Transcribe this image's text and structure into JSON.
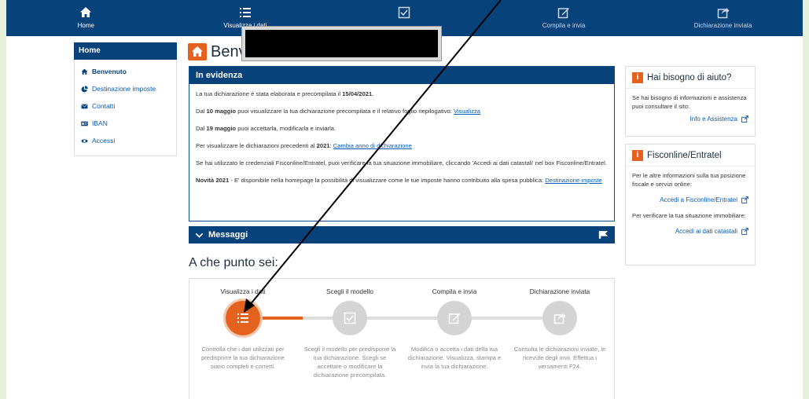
{
  "topnav": {
    "items": [
      {
        "label": "Home",
        "icon": "home-icon",
        "active": true
      },
      {
        "label": "Visualizza i dati",
        "icon": "list-icon",
        "active": true
      },
      {
        "label": "",
        "icon": "check-square-icon",
        "active": false
      },
      {
        "label": "Compila e invia",
        "icon": "edit-icon",
        "active": false
      },
      {
        "label": "Dichiarazione inviata",
        "icon": "share-icon",
        "active": false
      }
    ]
  },
  "sidebar": {
    "header": "Home",
    "items": [
      {
        "label": "Benvenuto",
        "icon": "home-icon"
      },
      {
        "label": "Destinazione imposte",
        "icon": "pie-chart-icon"
      },
      {
        "label": "Contatti",
        "icon": "envelope-icon"
      },
      {
        "label": "IBAN",
        "icon": "id-card-icon"
      },
      {
        "label": "Accessi",
        "icon": "eye-icon"
      }
    ]
  },
  "page": {
    "title": "Benv"
  },
  "evidenza": {
    "header": "In evidenza",
    "p1_pre": "La tua dichiarazione è stata elaborata e precompilata il ",
    "p1_bold": "15/04/2021",
    "p1_post": ".",
    "p2_pre": "Dal ",
    "p2_bold": "10 maggio",
    "p2_mid": " puoi visualizzare la tua dichiarazione precompilata e il relativo foglio riepilogativo: ",
    "p2_link": "Visualizza",
    "p3_pre": "Dal ",
    "p3_bold": "19 maggio",
    "p3_post": " puoi accettarla, modificarla e inviarla.",
    "p4_pre": "Per visualizzare le dichiarazioni precedenti al ",
    "p4_bold": "2021",
    "p4_mid": ": ",
    "p4_link": "Cambia anno di dichiarazione",
    "p5": "Se hai utilizzato le credenziali Fisconline/Entratel, puoi verificare la tua situazione immobiliare, cliccando 'Accedi ai dati catastali' nel box Fisconline/Entratel.",
    "p6_bold": "Novità 2021",
    "p6_post": " - E' disponibile nella homepage la possibilità di visualizzare come le tue imposte hanno contribuito alla spesa pubblica: ",
    "p6_link": "Destinazione imposte"
  },
  "messaggi": {
    "label": "Messaggi"
  },
  "progress": {
    "title": "A che punto sei:",
    "steps": [
      {
        "label": "Visualizza i dati",
        "desc": "Controlla che i dati utilizzati per predisporre la tua dichiarazione siano completi e corretti.",
        "active": true,
        "icon": "list-icon"
      },
      {
        "label": "Scegli il modello",
        "desc": "Scegli il modello per predisporre la tua dichiarazione. Scegli se accettare o modificare la dichiarazione precompilata.",
        "active": false,
        "icon": "check-square-icon"
      },
      {
        "label": "Compila e invia",
        "desc": "Modifica o accetta i dati della tua dichiarazione. Visualizza, stampa e invia la tua dichiarazione.",
        "active": false,
        "icon": "edit-icon"
      },
      {
        "label": "Dichiarazione inviata",
        "desc": "Consulta le dichiarazioni inviate, le ricevute degli invii. Effettua i versamenti F24.",
        "active": false,
        "icon": "share-icon"
      }
    ]
  },
  "help": {
    "title": "Hai bisogno di aiuto?",
    "text": "Se hai bisogno di informazioni e assistenza puoi consultare il sito:",
    "link": "Info e Assistenza"
  },
  "fisconline": {
    "title": "Fisconline/Entratel",
    "text1": "Per le altre informazioni sulla tua posizione fiscale e servizi online:",
    "link1": "Accedi a Fisconline/Entratel",
    "text2": "Per verificare la tua situazione immobiliare:",
    "link2": "Accedi ai dati catastali"
  },
  "colors": {
    "navy": "#08427b",
    "orange": "#e5621e",
    "link": "#0a5bb3",
    "background_frame": "#e6f0da"
  }
}
